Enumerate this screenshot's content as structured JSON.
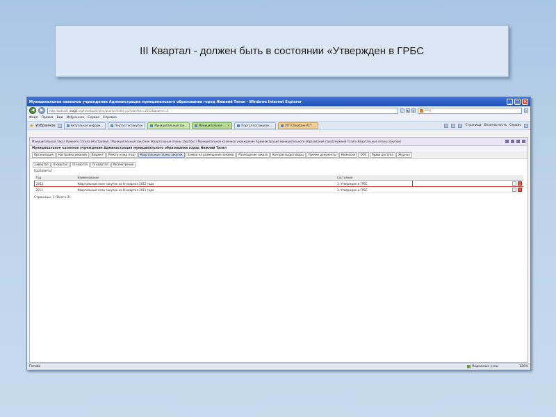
{
  "slide": {
    "title": "III Квартал - должен быть в состоянии «Утвержден в ГРБС"
  },
  "browser": {
    "window_title": "Муниципальное казенное учреждение Администрация муниципального образования город Нижний Тагил - Windows Internet Explorer",
    "url_prefix": "http://zakupki.",
    "url_host": "ntagil",
    "url_rest": ".org/fz/zakupki/plan/quarter/index.jsp?planYear=2012&quarter=3",
    "search_placeholder": "Bing",
    "menu": [
      "Файл",
      "Правка",
      "Вид",
      "Избранное",
      "Сервис",
      "Справка"
    ],
    "favorites_label": "Избранное",
    "tabs": [
      {
        "label": "Актуальная информ...",
        "style": ""
      },
      {
        "label": "Портал госзакупок",
        "style": ""
      },
      {
        "label": "Муниципальный зак...",
        "style": "green"
      },
      {
        "label": "Муниципальное ...",
        "style": "green2"
      },
      {
        "label": "Портал госзакупок ...",
        "style": ""
      },
      {
        "label": "ЭТП Сбербанк-АСТ ...",
        "style": "orange"
      }
    ],
    "tools": [
      "Страница",
      "Безопасность",
      "Сервис"
    ],
    "status_text": "Готово",
    "zone_text": "Надежные узлы",
    "zoom_text": "120%"
  },
  "page": {
    "breadcrumb": "Муниципальный заказ Нижнего Тагила (Настройки) / Муниципальный заказчик (Квартальные планы закупок) / Муниципальное казенное учреждение Администрация муниципального образования город Нижний Тагил (Квартальные планы закупок)",
    "org_title": "Муниципальное казенное учреждение Администрация муниципального образования город Нижний Тагил",
    "subnav": [
      "Организация",
      "Настройка ревизий",
      "Бюджет",
      "Реестр нужд (год)",
      "Квартальные планы закупок",
      "Заявки на размещение заказов",
      "Размещение заказа",
      "Контракты/договоры",
      "Прочие документы",
      "Комиссии",
      "ООС",
      "Права доступа",
      "Журнал"
    ],
    "quarter_tabs": [
      "I квартал",
      "II квартал",
      "III квартал",
      "IV квартал",
      "Рассмотрение"
    ],
    "add_link": "[добавить]",
    "columns": {
      "year": "Год",
      "name": "Наименование",
      "state": "Состояние"
    },
    "rows": [
      {
        "year": "2012",
        "name": "Квартальный план закупок на III квартал 2012 года",
        "state": "3. Утвержден в ГРБС",
        "highlight": true
      },
      {
        "year": "2011",
        "name": "Квартальный план закупок на III квартал 2011 года",
        "state": "3. Утвержден в ГРБС",
        "highlight": false
      }
    ],
    "pager": "Страницы: 1 (Всего 2)"
  },
  "colors": {
    "background": "#bcd3ea",
    "highlight_border": "#c0392b",
    "titlebar": "#1f4fb5"
  }
}
